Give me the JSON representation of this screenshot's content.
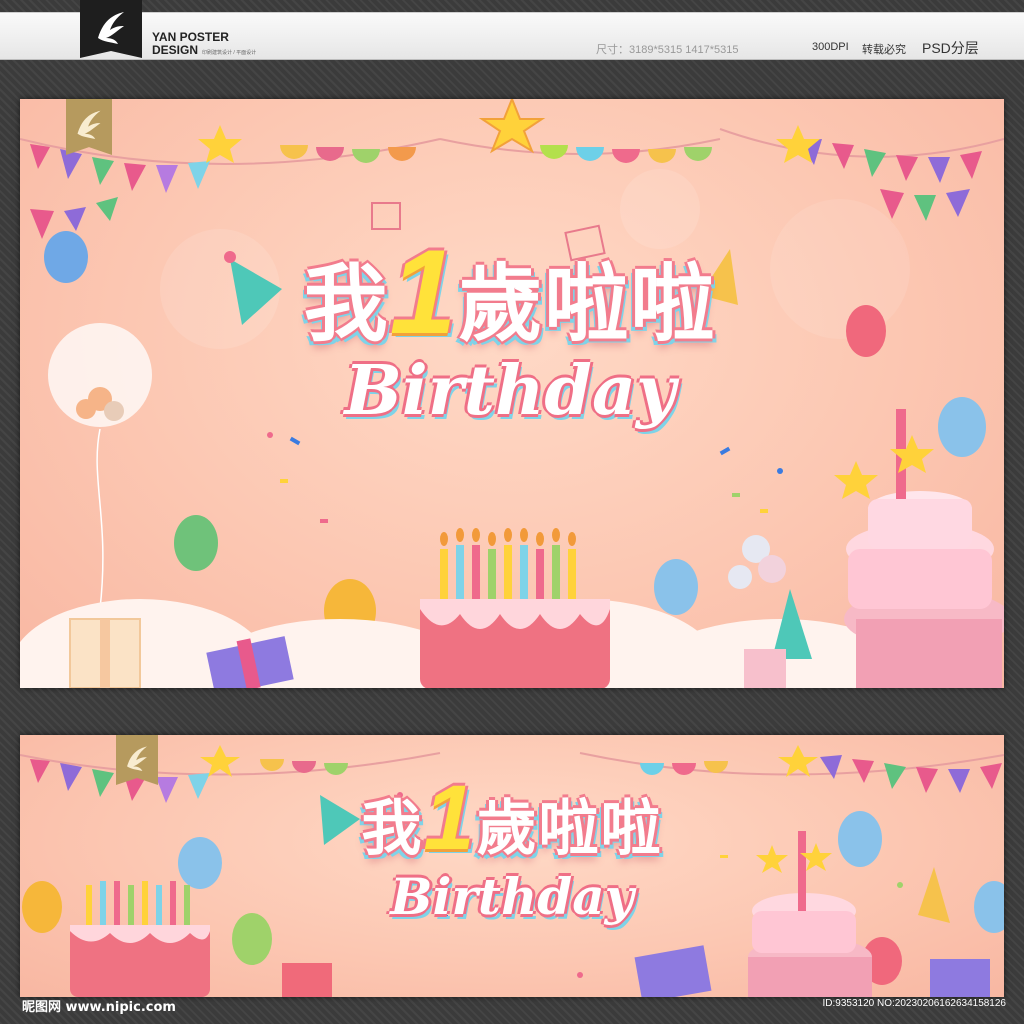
{
  "header": {
    "brand_line1": "YAN POSTER",
    "brand_line2": "DESIGN",
    "brand_small": "印刷建筑设计 / 平面设计",
    "size_spec": "尺寸：3189*5315  1417*5315",
    "dpi": "300DPI",
    "reprint_notice": "转载必究",
    "psd_label": "PSD分层"
  },
  "poster": {
    "title_wo": "我",
    "title_num": "1",
    "title_rest": "歲啦啦",
    "subtitle": "Birthday"
  },
  "footer": {
    "site_watermark": "昵图网 www.nipic.com",
    "image_id": "ID:9353120 NO:20230206162634158126"
  },
  "colors": {
    "background": "#3b3b3b",
    "poster_peach": "#fcc7b2",
    "title_outline": "#f27c8d",
    "title_number": "#ffe23a",
    "accent_blue": "#7ed3e8",
    "badge_gold": "#b69a5e"
  }
}
